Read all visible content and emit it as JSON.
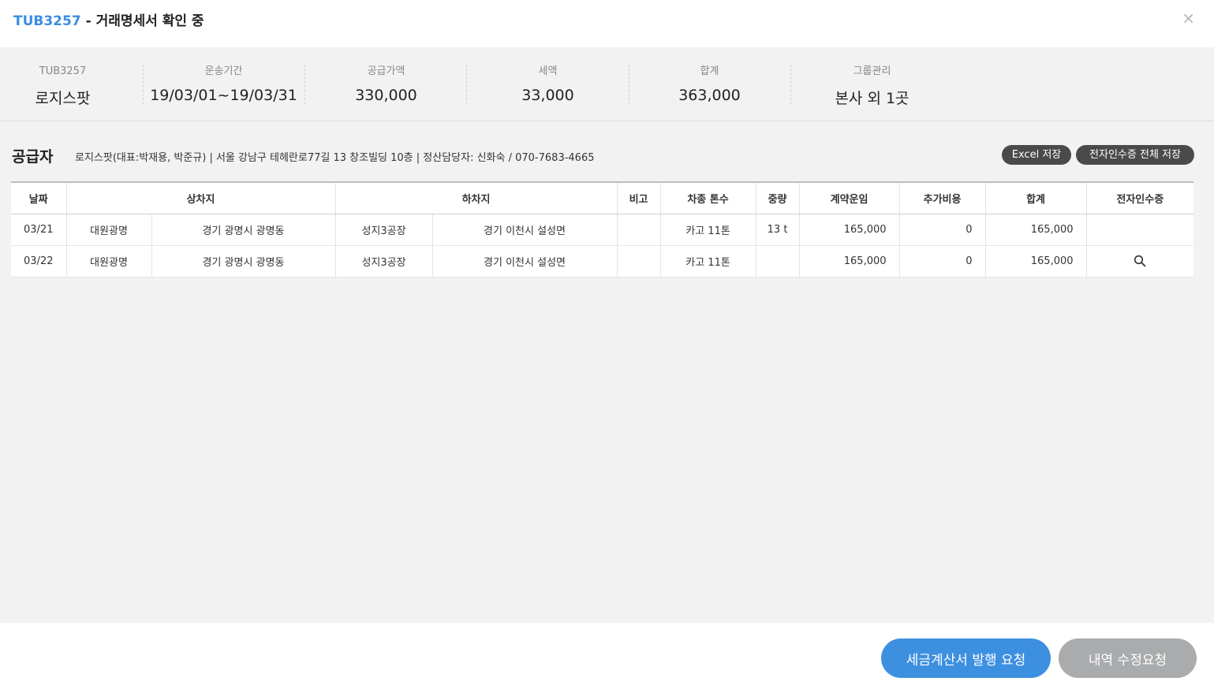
{
  "header": {
    "code": "TUB3257",
    "title_rest": " - 거래명세서 확인 중",
    "close_glyph": "×"
  },
  "summary": [
    {
      "label": "TUB3257",
      "value": "로지스팟"
    },
    {
      "label": "운송기간",
      "value": "19/03/01~19/03/31"
    },
    {
      "label": "공급가액",
      "value": "330,000"
    },
    {
      "label": "세액",
      "value": "33,000"
    },
    {
      "label": "합계",
      "value": "363,000"
    },
    {
      "label": "그룹관리",
      "value": "본사 외 1곳"
    }
  ],
  "supplier": {
    "label": "공급자",
    "info": "로지스팟(대표:박재용, 박준규)   |   서울 강남구 테헤란로77길 13 창조빌딩 10층   |   정산담당자: 신화숙 / 070-7683-4665",
    "excel_button": "Excel 저장",
    "receipt_all_button": "전자인수증 전체 저장"
  },
  "table": {
    "headers": [
      "날짜",
      "상차지",
      "하차지",
      "비고",
      "차종 톤수",
      "중량",
      "계약운임",
      "추가비용",
      "합계",
      "전자인수증"
    ],
    "rows": [
      {
        "date": "03/21",
        "load_name": "대원광명",
        "load_addr": "경기 광명시 광명동",
        "unload_name": "성지3공장",
        "unload_addr": "경기 이천시 설성면",
        "note": "",
        "vehicle": "카고 11톤",
        "weight": "13 t",
        "fare": "165,000",
        "extra": "0",
        "total": "165,000",
        "receipt_icon": ""
      },
      {
        "date": "03/22",
        "load_name": "대원광명",
        "load_addr": "경기 광명시 광명동",
        "unload_name": "성지3공장",
        "unload_addr": "경기 이천시 설성면",
        "note": "",
        "vehicle": "카고 11톤",
        "weight": "",
        "fare": "165,000",
        "extra": "0",
        "total": "165,000",
        "receipt_icon": "search-icon"
      }
    ]
  },
  "footer": {
    "issue_button": "세금계산서 발행 요청",
    "edit_button": "내역 수정요청"
  },
  "colors": {
    "accent": "#3d8fe0",
    "code": "#3a8de0",
    "gray_button": "#a9abad",
    "dark_button": "#4a4a4a"
  }
}
